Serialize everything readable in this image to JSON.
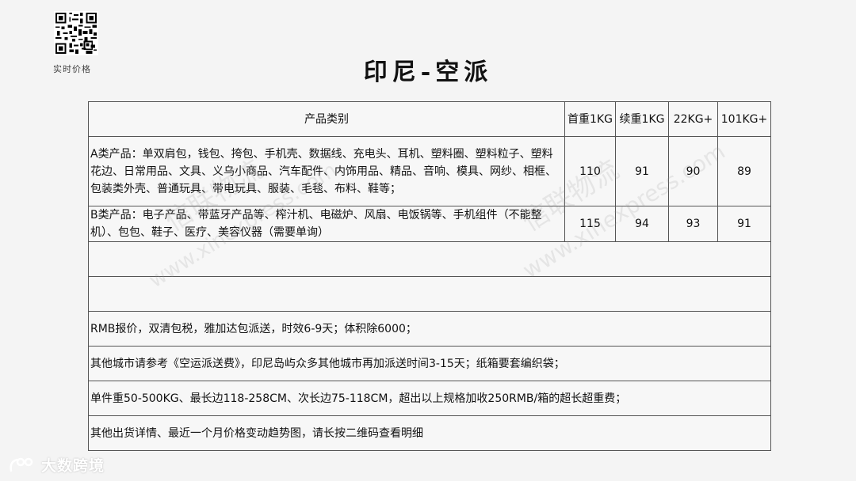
{
  "qr_label": "实时价格",
  "title": "印尼-空派",
  "table": {
    "headers": [
      "产品类别",
      "首重1KG",
      "续重1KG",
      "22KG+",
      "101KG+"
    ],
    "rows": [
      {
        "category": "A类产品：单双肩包，钱包、挎包、手机壳、数据线、充电头、耳机、塑料圈、塑料粒子、塑料花边、日常用品、文具、义乌小商品、汽车配件、内饰用品、精品、音响、模具、网纱、相框、包装类外壳、普通玩具、带电玩具、服装、毛毯、布料、鞋等；",
        "first_kg": "110",
        "additional_kg": "91",
        "kg22": "90",
        "kg101": "89"
      },
      {
        "category": "B类产品：电子产品、带蓝牙产品等、榨汁机、电磁炉、风扇、电饭锅等、手机组件（不能整机）、包包、鞋子、医疗、美容仪器（需要单询）",
        "first_kg": "115",
        "additional_kg": "94",
        "kg22": "93",
        "kg101": "91"
      }
    ],
    "notes": [
      "RMB报价，双清包税，雅加达包派送，时效6-9天；体积除6000；",
      "其他城市请参考《空运派送费》，印尼岛屿众多其他城市再加派送时间3-15天；纸箱要套编织袋；",
      "单件重50-500KG、最长边118-258CM、次长边75-118CM，超出以上规格加收250RMB/箱的超长超重费；",
      "其他出货详情、最近一个月价格变动趋势图，请长按二维码查看明细"
    ]
  },
  "watermarks": [
    "信联物流",
    "www.xinexpress.com",
    "信联物流",
    "www.xinexpress.com"
  ],
  "brand": "大数跨境"
}
